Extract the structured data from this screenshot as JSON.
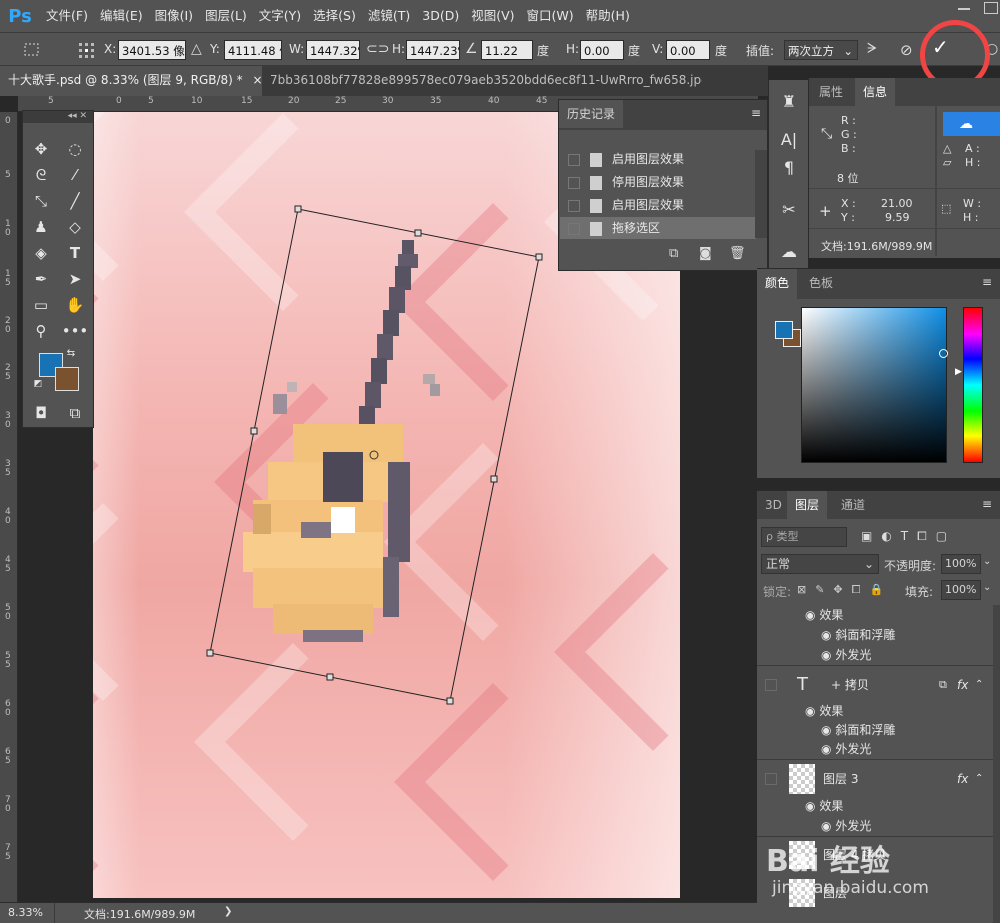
{
  "app": {
    "logo": "Ps",
    "menu": [
      "文件(F)",
      "编辑(E)",
      "图像(I)",
      "图层(L)",
      "文字(Y)",
      "选择(S)",
      "滤镜(T)",
      "3D(D)",
      "视图(V)",
      "窗口(W)",
      "帮助(H)"
    ]
  },
  "options": {
    "x_label": "X:",
    "x_value": "3401.53 像",
    "y_label": "Y:",
    "y_value": "4111.48 像",
    "w_label": "W:",
    "w_value": "1447.32%",
    "h_label": "H:",
    "h_value": "1447.23%",
    "angle_value": "11.22",
    "angle_unit": "度",
    "hskew_label": "H:",
    "hskew_value": "0.00",
    "hskew_unit": "度",
    "vskew_label": "V:",
    "vskew_value": "0.00",
    "vskew_unit": "度",
    "interp_label": "插值:",
    "interp_value": "两次立方",
    "commit_symbol": "✓",
    "cancel_symbol": "⊘"
  },
  "tabs": [
    {
      "label": "十大歌手.psd @ 8.33% (图层 9, RGB/8) *",
      "close": "×"
    },
    {
      "label": "7bb36108bf77828e899578ec079aeb3520bdd6ec8f11-UwRrro_fw658.jpg @ 2..."
    }
  ],
  "ruler": {
    "top": [
      "5",
      "0",
      "5",
      "10",
      "15",
      "20",
      "25",
      "30",
      "35",
      "40",
      "45"
    ],
    "left": [
      "0",
      "5",
      "1\n0",
      "1\n5",
      "2\n0",
      "2\n5",
      "3\n0",
      "3\n5",
      "4\n0",
      "4\n5",
      "5\n0",
      "5\n5",
      "6\n0",
      "6\n5",
      "7\n0",
      "7\n5"
    ]
  },
  "history": {
    "title": "历史记录",
    "items": [
      "启用图层效果",
      "停用图层效果",
      "启用图层效果",
      "拖移选区"
    ]
  },
  "props": {
    "tab_properties": "属性",
    "tab_info": "信息",
    "r": "R :",
    "g": "G :",
    "b": "B :",
    "c": "C :",
    "m": "M :",
    "y": "Y :",
    "k": "K :",
    "a": "A :",
    "h": "H :",
    "bits": "8 位",
    "x_label": "X :",
    "x_value": "21.00",
    "y_label": "Y :",
    "y_value": "9.59",
    "w_label": "W :",
    "h_label": "H :",
    "doc": "文档:191.6M/989.9M"
  },
  "color_panel": {
    "tab_color": "颜色",
    "tab_swatches": "色板",
    "fg": "#1873b5",
    "bg": "#7a5230"
  },
  "layers": {
    "tab_3d": "3D",
    "tab_layers": "图层",
    "tab_channels": "通道",
    "filter_label": "ρ 类型",
    "blend": "正常",
    "opacity_label": "不透明度:",
    "opacity_value": "100%",
    "lock_label": "锁定:",
    "fill_label": "填充:",
    "fill_value": "100%",
    "rows": [
      {
        "name": "效果",
        "kind": "effects"
      },
      {
        "name": "斜面和浮雕",
        "kind": "effect"
      },
      {
        "name": "外发光",
        "kind": "effect"
      },
      {
        "name": "+ 拷贝",
        "kind": "text-layer"
      },
      {
        "name": "效果",
        "kind": "effects"
      },
      {
        "name": "斜面和浮雕",
        "kind": "effect"
      },
      {
        "name": "外发光",
        "kind": "effect"
      },
      {
        "name": "图层 3",
        "kind": "pixel-layer"
      },
      {
        "name": "效果",
        "kind": "effects"
      },
      {
        "name": "外发光",
        "kind": "effect"
      },
      {
        "name": "图层 4 拷贝",
        "kind": "pixel-layer"
      },
      {
        "name": "图层",
        "kind": "pixel-layer"
      }
    ]
  },
  "status": {
    "zoom": "8.33%",
    "doc": "文档:191.6M/989.9M",
    "arrow": "❯"
  },
  "watermark": {
    "text": "Bai 经验",
    "url": "jingyan.baidu.com"
  }
}
